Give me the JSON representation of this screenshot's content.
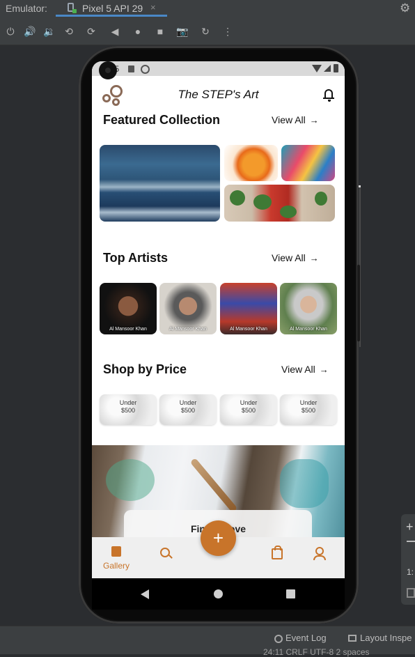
{
  "ide": {
    "emulator_label": "Emulator:",
    "device_tab": "Pixel 5 API 29",
    "tab_close": "×",
    "event_log": "Event Log",
    "layout_inspector": "Layout Inspe",
    "status_line": "24:11   CRLF   UTF-8   2 spaces"
  },
  "side_panel": {
    "zoom_ratio": "1:"
  },
  "phone": {
    "status_time": "11:05",
    "app_title": "The STEP's Art",
    "featured": {
      "title": "Featured Collection",
      "view_all": "View All",
      "arrow": "→"
    },
    "top_artists": {
      "title": "Top Artists",
      "view_all": "View All",
      "arrow": "→",
      "artists": [
        "Al Mansoor Khan",
        "Al Mansoor Khan",
        "Al Mansoor Khan",
        "Al Mansoor Khan"
      ]
    },
    "shop_by_price": {
      "title": "Shop by Price",
      "view_all": "View All",
      "arrow": "→",
      "tiles": [
        "Under\n$500",
        "Under\n$500",
        "Under\n$500",
        "Under\n$500"
      ]
    },
    "banner_text": "Find A   Love",
    "fab_label": "+",
    "bottom_nav": {
      "gallery_label": "Gallery"
    }
  },
  "colors": {
    "accent": "#c8742a",
    "ide_bg": "#3c3f41",
    "stage_bg": "#2b2d30"
  }
}
